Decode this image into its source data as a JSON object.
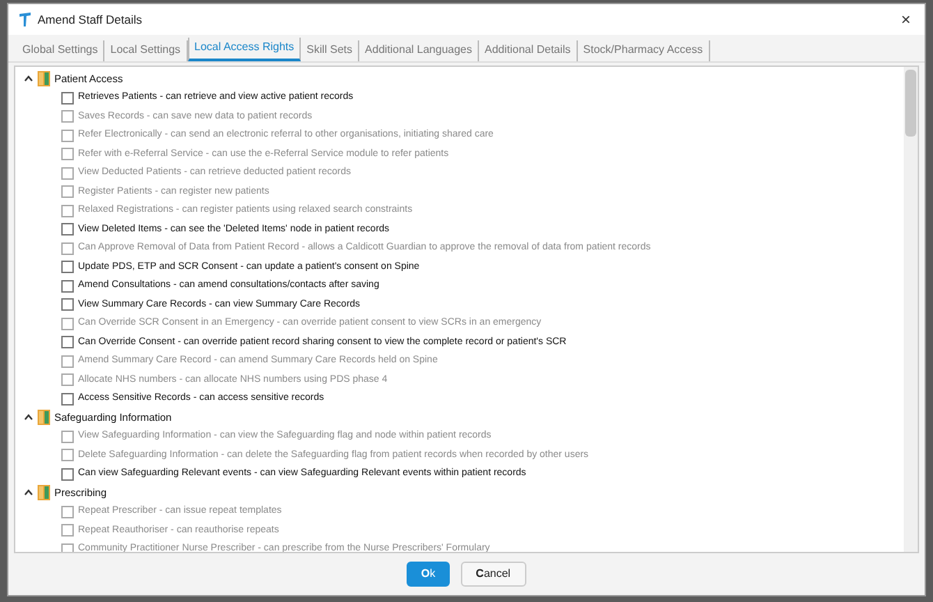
{
  "window": {
    "title": "Amend Staff Details",
    "close": "×"
  },
  "tabs": [
    {
      "label": "Global Settings",
      "selected": false
    },
    {
      "label": "Local Settings",
      "selected": false
    },
    {
      "label": "Local Access Rights",
      "selected": true
    },
    {
      "label": "Skill Sets",
      "selected": false
    },
    {
      "label": "Additional Languages",
      "selected": false
    },
    {
      "label": "Additional Details",
      "selected": false
    },
    {
      "label": "Stock/Pharmacy Access",
      "selected": false
    }
  ],
  "groups": [
    {
      "title": "Patient Access",
      "expanded": true,
      "items": [
        {
          "label": "Retrieves Patients  -  can retrieve and view active patient records",
          "checked": false,
          "disabled": false
        },
        {
          "label": "Saves Records  -  can save new data to patient records",
          "checked": false,
          "disabled": true
        },
        {
          "label": "Refer Electronically  -  can send an electronic referral to other organisations, initiating shared care",
          "checked": false,
          "disabled": true
        },
        {
          "label": "Refer with e-Referral Service  -  can use the e-Referral Service module to refer patients",
          "checked": false,
          "disabled": true
        },
        {
          "label": "View Deducted Patients  -  can retrieve deducted patient records",
          "checked": false,
          "disabled": true
        },
        {
          "label": "Register Patients  -  can register new patients",
          "checked": false,
          "disabled": true
        },
        {
          "label": "Relaxed Registrations  -  can register patients using relaxed search constraints",
          "checked": false,
          "disabled": true
        },
        {
          "label": "View Deleted Items  -  can see the 'Deleted Items' node in patient records",
          "checked": false,
          "disabled": false
        },
        {
          "label": "Can Approve Removal of Data from Patient Record  -  allows a Caldicott Guardian to approve the removal of data from patient records",
          "checked": false,
          "disabled": true
        },
        {
          "label": "Update PDS, ETP and SCR Consent  -  can update a patient's consent on Spine",
          "checked": false,
          "disabled": false
        },
        {
          "label": "Amend Consultations  -  can amend consultations/contacts after saving",
          "checked": false,
          "disabled": false
        },
        {
          "label": "View Summary Care Records  -  can view Summary Care Records",
          "checked": false,
          "disabled": false
        },
        {
          "label": "Can Override SCR Consent in an Emergency  -  can override patient consent to view SCRs in an emergency",
          "checked": false,
          "disabled": true
        },
        {
          "label": "Can Override Consent  -  can override patient record sharing consent to view the complete record or patient's SCR",
          "checked": false,
          "disabled": false
        },
        {
          "label": "Amend Summary Care Record  -  can amend Summary Care Records held on Spine",
          "checked": false,
          "disabled": true
        },
        {
          "label": "Allocate NHS numbers  -  can allocate NHS numbers using PDS phase 4",
          "checked": false,
          "disabled": true
        },
        {
          "label": "Access Sensitive Records  -  can access sensitive records",
          "checked": false,
          "disabled": false
        }
      ]
    },
    {
      "title": "Safeguarding Information",
      "expanded": true,
      "items": [
        {
          "label": "View Safeguarding Information  -  can view the Safeguarding flag and node within patient records",
          "checked": false,
          "disabled": true
        },
        {
          "label": "Delete Safeguarding Information  -  can delete the Safeguarding flag from patient records when recorded by other users",
          "checked": false,
          "disabled": true
        },
        {
          "label": "Can view Safeguarding Relevant events  -  can view Safeguarding Relevant events within patient records",
          "checked": false,
          "disabled": false
        }
      ]
    },
    {
      "title": "Prescribing",
      "expanded": true,
      "items": [
        {
          "label": "Repeat Prescriber  -  can issue repeat templates",
          "checked": false,
          "disabled": true
        },
        {
          "label": "Repeat Reauthoriser  -  can reauthorise repeats",
          "checked": false,
          "disabled": true
        },
        {
          "label": "Community Practitioner Nurse Prescriber  -  can prescribe from the Nurse Prescribers' Formulary",
          "checked": false,
          "disabled": true
        }
      ]
    }
  ],
  "buttons": [
    {
      "label": "**O**k",
      "kind": "primary"
    },
    {
      "label": "**C**ancel",
      "kind": "secondary"
    }
  ]
}
